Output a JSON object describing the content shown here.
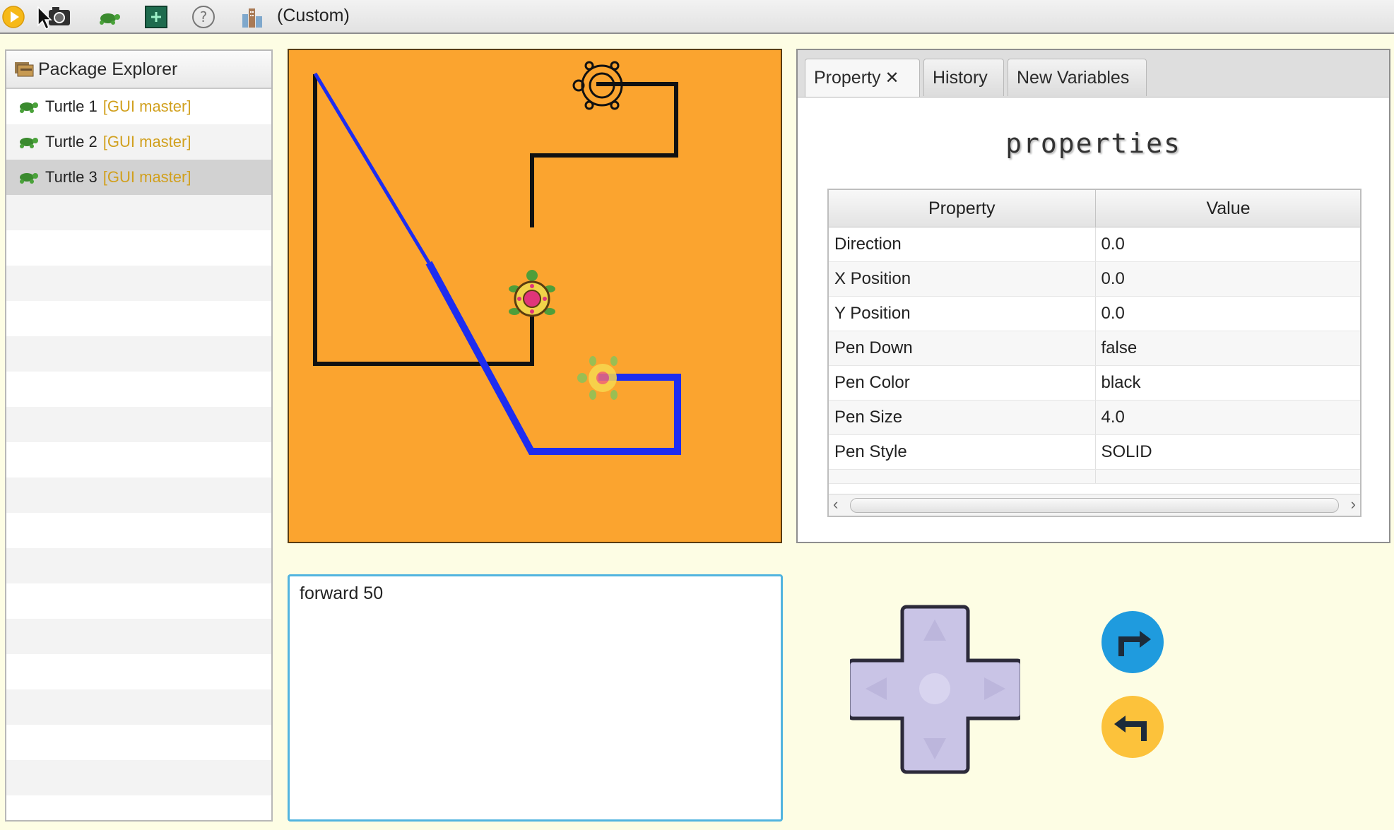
{
  "toolbar": {
    "buttons": [
      {
        "name": "run-icon"
      },
      {
        "name": "camera-icon"
      },
      {
        "name": "turtle-icon"
      },
      {
        "name": "new-workspace-icon"
      },
      {
        "name": "help-icon"
      },
      {
        "name": "city-icon"
      }
    ],
    "workspace_label": "(Custom)"
  },
  "explorer": {
    "title": "Package Explorer",
    "items": [
      {
        "name": "Turtle 1",
        "tag": "[GUI master]",
        "selected": false
      },
      {
        "name": "Turtle 2",
        "tag": "[GUI master]",
        "selected": false
      },
      {
        "name": "Turtle 3",
        "tag": "[GUI master]",
        "selected": true
      }
    ]
  },
  "canvas": {
    "background": "#fba42f"
  },
  "panel": {
    "tabs": [
      {
        "label": "Property",
        "closable": true,
        "active": true
      },
      {
        "label": "History",
        "closable": false,
        "active": false
      },
      {
        "label": "New Variables",
        "closable": false,
        "active": false
      }
    ],
    "close_symbol": "✕",
    "heading": "properties",
    "columns": [
      "Property",
      "Value"
    ],
    "rows": [
      {
        "property": "Direction",
        "value": "0.0"
      },
      {
        "property": "X Position",
        "value": "0.0"
      },
      {
        "property": "Y Position",
        "value": "0.0"
      },
      {
        "property": "Pen Down",
        "value": "false"
      },
      {
        "property": "Pen Color",
        "value": "black"
      },
      {
        "property": "Pen Size",
        "value": "4.0"
      },
      {
        "property": "Pen Style",
        "value": "SOLID"
      }
    ]
  },
  "command": {
    "text": "forward 50"
  },
  "controls": {
    "turn_right_color": "#1f9bde",
    "turn_left_color": "#fcc23b"
  }
}
